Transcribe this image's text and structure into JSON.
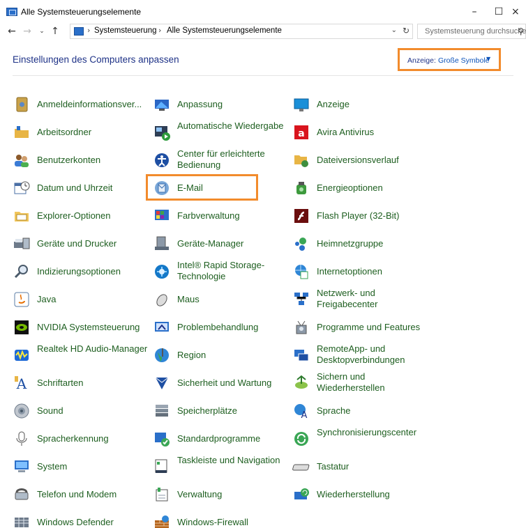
{
  "window": {
    "title": "Alle Systemsteuerungselemente",
    "minimize_glyph": "–",
    "maximize_glyph": "☐",
    "close_glyph": "×"
  },
  "address": {
    "breadcrumb": [
      "Systemsteuerung",
      "Alle Systemsteuerungselemente"
    ],
    "separator": "›",
    "search_placeholder": "Systemsteuerung durchsuchen"
  },
  "header": {
    "title": "Einstellungen des Computers anpassen",
    "view_label": "Anzeige:",
    "view_value": "Große Symbole"
  },
  "colors": {
    "link_green": "#1d5e1f",
    "heading_blue": "#1e3287",
    "highlight_orange": "#f28b2c"
  },
  "items": [
    {
      "label": "Anmeldeinformationsver...",
      "icon": "credential-manager-icon"
    },
    {
      "label": "Anpassung",
      "icon": "personalization-icon"
    },
    {
      "label": "Anzeige",
      "icon": "display-icon"
    },
    {
      "label": "Arbeitsordner",
      "icon": "work-folders-icon"
    },
    {
      "label": "Automatische Wiedergabe",
      "icon": "autoplay-icon"
    },
    {
      "label": "Avira Antivirus",
      "icon": "avira-icon"
    },
    {
      "label": "Benutzerkonten",
      "icon": "user-accounts-icon"
    },
    {
      "label": "Center für erleichterte Bedienung",
      "icon": "ease-of-access-icon"
    },
    {
      "label": "Dateiversionsverlauf",
      "icon": "file-history-icon"
    },
    {
      "label": "Datum und Uhrzeit",
      "icon": "date-time-icon"
    },
    {
      "label": "E-Mail",
      "icon": "mail-icon"
    },
    {
      "label": "Energieoptionen",
      "icon": "power-options-icon"
    },
    {
      "label": "Explorer-Optionen",
      "icon": "explorer-options-icon"
    },
    {
      "label": "Farbverwaltung",
      "icon": "color-management-icon"
    },
    {
      "label": "Flash Player (32-Bit)",
      "icon": "flash-player-icon"
    },
    {
      "label": "Geräte und Drucker",
      "icon": "devices-printers-icon"
    },
    {
      "label": "Geräte-Manager",
      "icon": "device-manager-icon"
    },
    {
      "label": "Heimnetzgruppe",
      "icon": "homegroup-icon"
    },
    {
      "label": "Indizierungsoptionen",
      "icon": "indexing-options-icon"
    },
    {
      "label": "Intel® Rapid Storage-Technologie",
      "icon": "intel-rst-icon"
    },
    {
      "label": "Internetoptionen",
      "icon": "internet-options-icon"
    },
    {
      "label": "Java",
      "icon": "java-icon"
    },
    {
      "label": "Maus",
      "icon": "mouse-icon"
    },
    {
      "label": "Netzwerk- und Freigabecenter",
      "icon": "network-sharing-icon"
    },
    {
      "label": "NVIDIA Systemsteuerung",
      "icon": "nvidia-icon"
    },
    {
      "label": "Problembehandlung",
      "icon": "troubleshooting-icon"
    },
    {
      "label": "Programme und Features",
      "icon": "programs-features-icon"
    },
    {
      "label": "Realtek HD Audio-Manager",
      "icon": "realtek-audio-icon"
    },
    {
      "label": "Region",
      "icon": "region-icon"
    },
    {
      "label": "RemoteApp- und Desktopverbindungen",
      "icon": "remoteapp-icon"
    },
    {
      "label": "Schriftarten",
      "icon": "fonts-icon"
    },
    {
      "label": "Sicherheit und Wartung",
      "icon": "security-maintenance-icon"
    },
    {
      "label": "Sichern und Wiederherstellen",
      "icon": "backup-restore-icon"
    },
    {
      "label": "Sound",
      "icon": "sound-icon"
    },
    {
      "label": "Speicherplätze",
      "icon": "storage-spaces-icon"
    },
    {
      "label": "Sprache",
      "icon": "language-icon"
    },
    {
      "label": "Spracherkennung",
      "icon": "speech-recognition-icon"
    },
    {
      "label": "Standardprogramme",
      "icon": "default-programs-icon"
    },
    {
      "label": "Synchronisierungscenter",
      "icon": "sync-center-icon"
    },
    {
      "label": "System",
      "icon": "system-icon"
    },
    {
      "label": "Taskleiste und Navigation",
      "icon": "taskbar-icon"
    },
    {
      "label": "Tastatur",
      "icon": "keyboard-icon"
    },
    {
      "label": "Telefon und Modem",
      "icon": "phone-modem-icon"
    },
    {
      "label": "Verwaltung",
      "icon": "administrative-tools-icon"
    },
    {
      "label": "Wiederherstellung",
      "icon": "recovery-icon"
    },
    {
      "label": "Windows Defender",
      "icon": "windows-defender-icon"
    },
    {
      "label": "Windows-Firewall",
      "icon": "windows-firewall-icon"
    }
  ]
}
